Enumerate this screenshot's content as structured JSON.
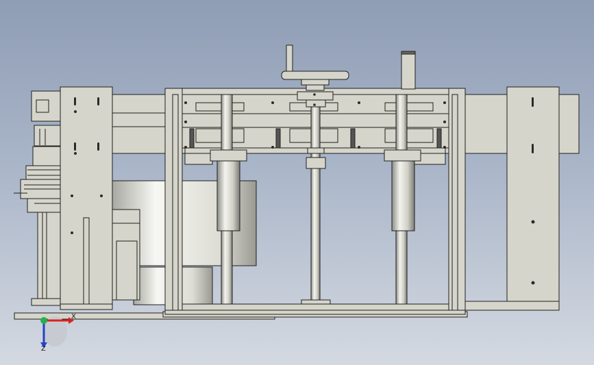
{
  "viewport": {
    "background_top": "#8f9db5",
    "background_bottom": "#d4d9e1",
    "model_face_color": "#d6d5cb",
    "model_edge_color": "#1e1e1e"
  },
  "triad": {
    "x_label": "X",
    "z_label": "Z",
    "x_color": "#d8231f",
    "y_color": "#22b24c",
    "z_color": "#2343c8"
  }
}
